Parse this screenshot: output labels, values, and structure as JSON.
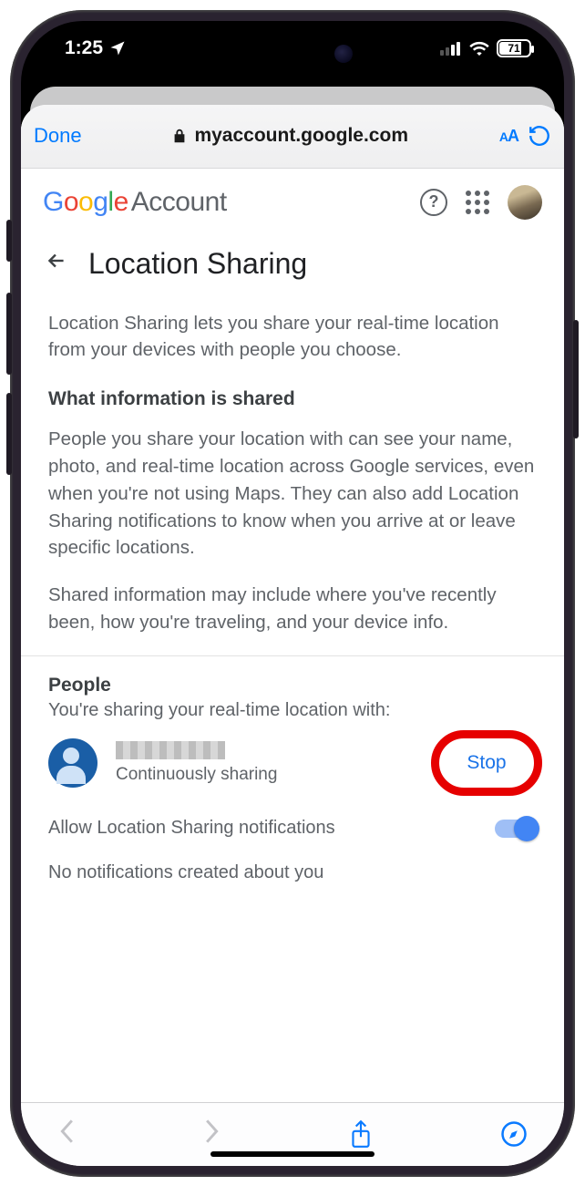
{
  "statusbar": {
    "time": "1:25",
    "battery_pct": "71"
  },
  "safari": {
    "done": "Done",
    "url": "myaccount.google.com",
    "aa_small": "A",
    "aa_large": "A"
  },
  "google_header": {
    "g1": "G",
    "g2": "o",
    "g3": "o",
    "g4": "g",
    "g5": "l",
    "g6": "e",
    "account": " Account"
  },
  "page": {
    "title": "Location Sharing",
    "intro": "Location Sharing lets you share your real-time location from your devices with people you choose.",
    "section_heading": "What information is shared",
    "para1": "People you share your location with can see your name, photo, and real-time location across Google services, even when you're not using Maps. They can also add Location Sharing notifications to know when you arrive at or leave specific locations.",
    "para2": "Shared information may include where you've recently been, how you're traveling, and your device info."
  },
  "people": {
    "heading": "People",
    "subheading": "You're sharing your real-time location with:",
    "person_sub": "Continuously sharing",
    "stop": "Stop",
    "notif_label": "Allow Location Sharing notifications",
    "no_notif": "No notifications created about you"
  }
}
